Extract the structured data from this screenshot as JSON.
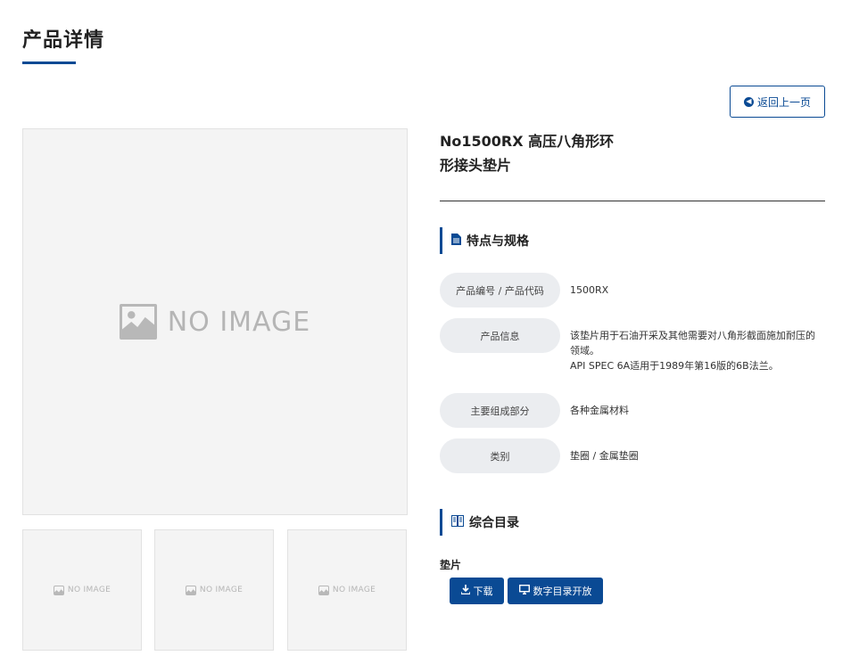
{
  "page": {
    "title": "产品详情"
  },
  "back_button": {
    "label": "返回上一页",
    "icon": "arrow-left-circle-icon"
  },
  "product": {
    "name_line1": "No1500RX 高压八角形环",
    "name_line2": "形接头垫片"
  },
  "gallery": {
    "main_placeholder": "NO IMAGE",
    "thumb_placeholder": "NO IMAGE",
    "thumb_count": 3
  },
  "specs_section": {
    "title": "特点与规格",
    "icon": "document-icon",
    "rows": [
      {
        "label": "产品编号 / 产品代码",
        "value_lines": [
          "1500RX"
        ]
      },
      {
        "label": "产品信息",
        "value_lines": [
          "该垫片用于石油开采及其他需要对八角形截面施加耐压的",
          "领域。",
          "API SPEC 6A适用于1989年第16版的6B法兰。"
        ]
      },
      {
        "label": "主要组成部分",
        "value_lines": [
          "各种金属材料"
        ]
      },
      {
        "label": "类别",
        "value_lines": [
          "垫圈 / 金属垫圈"
        ]
      }
    ]
  },
  "catalog_section": {
    "title": "综合目录",
    "icon": "book-icon",
    "category": "垫片",
    "download_label": "下载",
    "digital_label": "数字目录开放"
  },
  "colors": {
    "accent": "#0a4a94",
    "label_bg": "#ebedf0",
    "placeholder_bg": "#f4f4f4"
  }
}
